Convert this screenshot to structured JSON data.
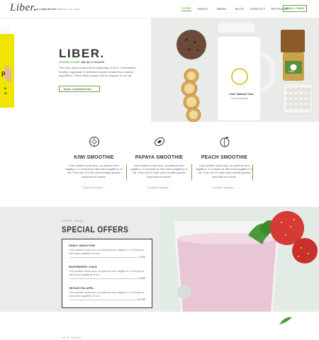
{
  "header": {
    "logo": "Liber.",
    "contact_call": "Call Us (805) 305 7047",
    "contact_address": "784 Brown Lane, France",
    "nav": [
      {
        "label": "HOME",
        "active": true,
        "dropdown": false
      },
      {
        "label": "ABOUT",
        "active": false,
        "dropdown": true
      },
      {
        "label": "MENU",
        "active": false,
        "dropdown": true
      },
      {
        "label": "BLOG",
        "active": false,
        "dropdown": false
      },
      {
        "label": "CONTACT",
        "active": false,
        "dropdown": false
      },
      {
        "label": "FEATURES",
        "active": false,
        "dropdown": true
      }
    ],
    "book_button": "BOOK A TABLE"
  },
  "hero": {
    "title": "LIBER.",
    "hours_label": "OPENING HOURS:",
    "hours_value": "MO-SA 17:00-23:00",
    "description": "The Liber was founded at the beginning of 2014. It celebrates healthy, vegetarian & delicious recipes created from natural ingredients. These tasty recipes can be enjoyed in our bar.",
    "reserve_button": "MAKE A RESERVATION",
    "teapot_brand": "Liber Natural Teas",
    "teapot_tagline": "Cover your body",
    "jar_label": "Liber"
  },
  "smoothies": [
    {
      "icon": "kiwi-icon",
      "title": "KIWI SMOOTHIE",
      "text": "Cras sodales luctus arcu, ac placerat nunc sagittis a. In ut turpis ac nibh luctus sagittis in et est. Proin sed ex vitae velit convallis gravida imperdiet eu mauris.",
      "more": "Continue reading"
    },
    {
      "icon": "papaya-icon",
      "title": "PAPAYA SMOOTHIE",
      "text": "Cras sodales luctus arcu, ac placerat nunc sagittis a. In ut turpis ac nibh luctus sagittis in et est. Proin sed ex vitae velit convallis gravida imperdiet eu mauris.",
      "more": "Continue reading"
    },
    {
      "icon": "peach-icon",
      "title": "PEACH SMOOTHIE",
      "text": "Cras sodales luctus arcu, ac placerat nunc sagittis a. In ut turpis ac nibh luctus sagittis in et est. Proin sed ex vitae velit convallis gravida imperdiet eu mauris.",
      "more": "Continue reading"
    }
  ],
  "offers": {
    "eyebrow": "TASTE TODAY",
    "title": "SPECIAL OFFERS",
    "items": [
      {
        "name": "PINKY SMOOTHIE",
        "text": "Cras sodales luctus arcu, ac placerat nunc sagittis a. In ut turpis ac nibh luctus sagittis in et est.",
        "price": "7,00€"
      },
      {
        "name": "RASPBERRY CAKE",
        "text": "Cras sodales luctus arcu, ac placerat nunc sagittis a. In ut turpis ac nibh luctus sagittis in et est.",
        "price": "5,00€"
      },
      {
        "name": "VEGAN FALAFEL",
        "text": "Cras sodales luctus arcu, ac placerat nunc sagittis a. In ut turpis ac nibh luctus sagittis in et est.",
        "price": "25,00€"
      }
    ]
  },
  "footer": {
    "eyebrow": "JOIN TODAY"
  },
  "colors": {
    "accent": "#6aa84f",
    "text": "#333333",
    "panel": "#eaece9"
  }
}
